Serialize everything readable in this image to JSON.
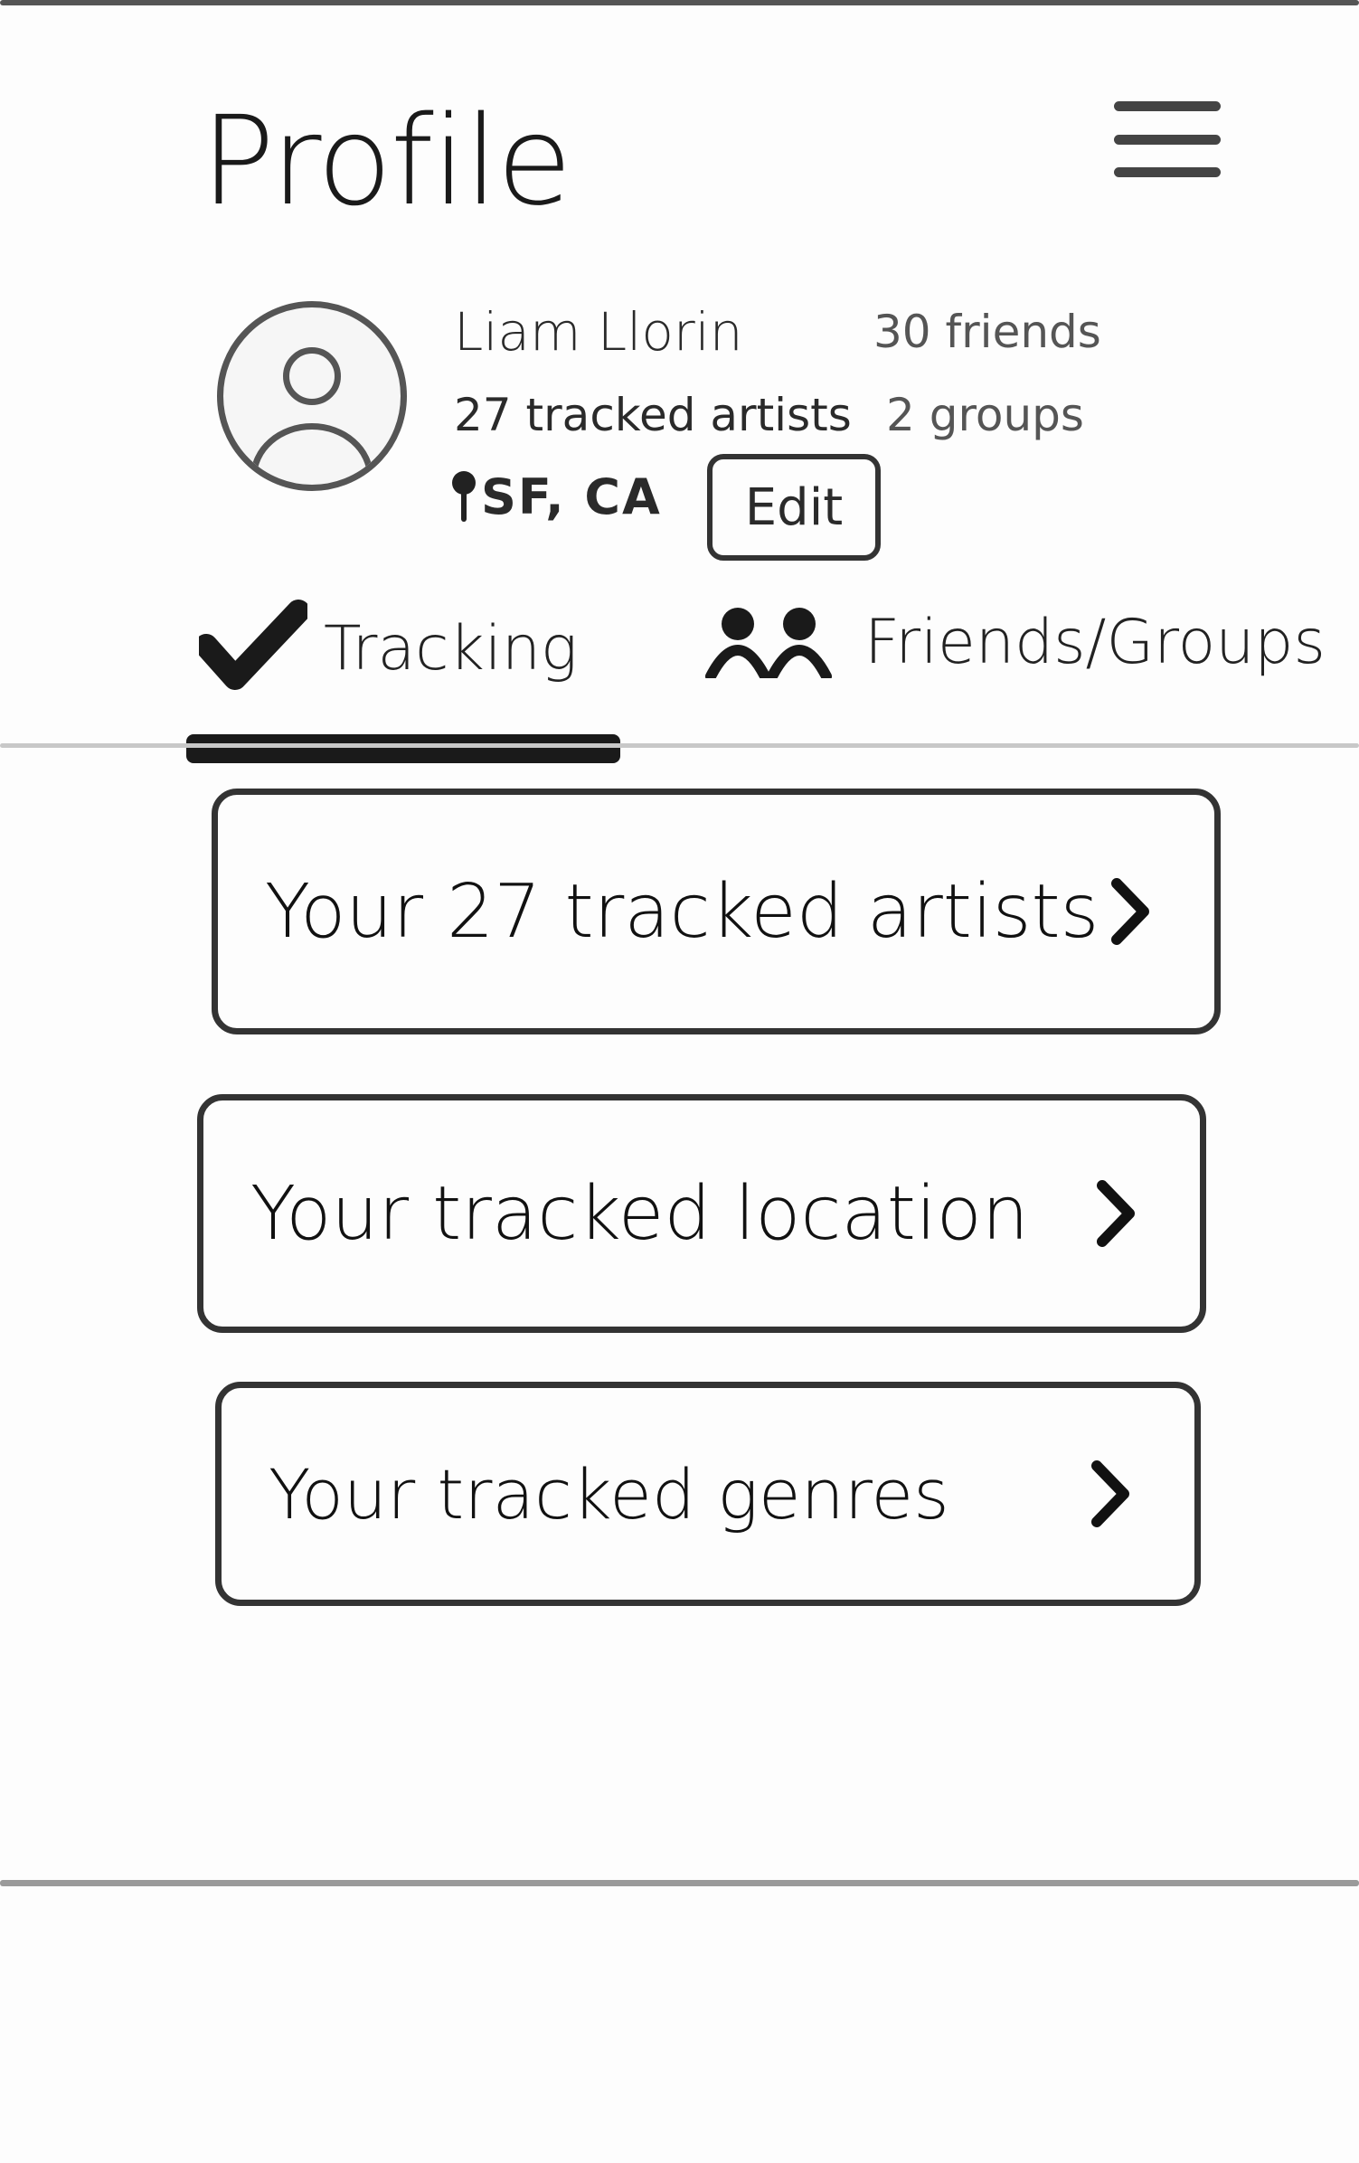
{
  "header": {
    "title": "Profile",
    "menu_icon": "hamburger-menu-icon"
  },
  "profile": {
    "avatar_icon": "user-avatar-icon",
    "name": "Liam Llorin",
    "tracked_artists": "27 tracked artists",
    "friends": "30 friends",
    "groups": "2 groups",
    "location_icon": "map-pin-icon",
    "location": "SF, CA",
    "edit_label": "Edit"
  },
  "tabs": [
    {
      "label": "Tracking",
      "icon": "checkmark-icon",
      "active": true
    },
    {
      "label": "Friends/Groups",
      "icon": "people-icon",
      "active": false
    }
  ],
  "tracking_list": [
    {
      "label": "Your 27 tracked artists",
      "icon": "chevron-right-icon"
    },
    {
      "label": "Your tracked location",
      "icon": "chevron-right-icon"
    },
    {
      "label": "Your tracked genres",
      "icon": "chevron-right-icon"
    }
  ]
}
